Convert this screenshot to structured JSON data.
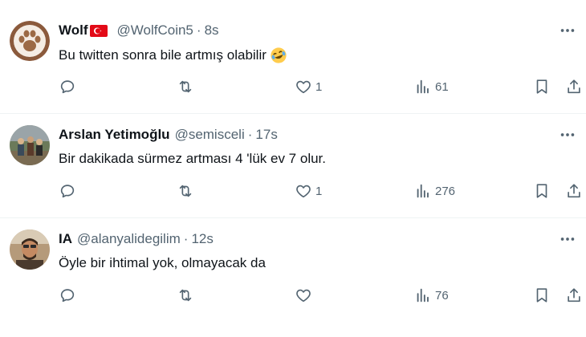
{
  "tweets": [
    {
      "name": "Wolf",
      "flag": "turkey-flag",
      "handle": "@WolfCoin5",
      "sep": "·",
      "time": "8s",
      "text": "Bu twitten sonra bile artmış olabilir",
      "emoji": "rolling-on-floor-laughing",
      "likes": "1",
      "views": "61",
      "avatar": "paw-avatar"
    },
    {
      "name": "Arslan Yetimoğlu",
      "handle": "@semisceli",
      "sep": "·",
      "time": "17s",
      "text": "Bir dakikada sürmez artması 4 'lük ev 7 olur.",
      "likes": "1",
      "views": "276",
      "avatar": "group-photo-avatar"
    },
    {
      "name": "IA",
      "handle": "@alanyalidegilim",
      "sep": "·",
      "time": "12s",
      "text": "Öyle bir ihtimal yok, olmayacak da",
      "likes": "",
      "views": "76",
      "avatar": "man-photo-avatar"
    }
  ],
  "colors": {
    "text": "#0f1419",
    "secondary": "#536471",
    "divider": "#eff3f4",
    "flag_red": "#e30a17"
  }
}
